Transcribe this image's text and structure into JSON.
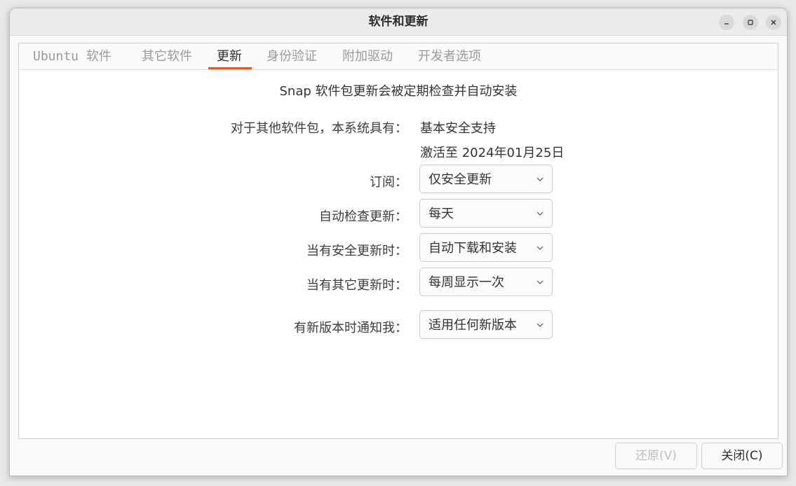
{
  "window": {
    "title": "软件和更新"
  },
  "tabs": [
    {
      "label": "Ubuntu 软件",
      "active": false
    },
    {
      "label": "其它软件",
      "active": false
    },
    {
      "label": "更新",
      "active": true
    },
    {
      "label": "身份验证",
      "active": false
    },
    {
      "label": "附加驱动",
      "active": false
    },
    {
      "label": "开发者选项",
      "active": false
    }
  ],
  "updates": {
    "snap_note": "Snap 软件包更新会被定期检查并自动安装",
    "other_packages_label": "对于其他软件包，本系统具有：",
    "other_packages_value": "基本安全支持",
    "activation": "激活至 2024年01月25日",
    "subscription_label": "订阅：",
    "subscription_value": "仅安全更新",
    "auto_check_label": "自动检查更新：",
    "auto_check_value": "每天",
    "security_updates_label": "当有安全更新时：",
    "security_updates_value": "自动下载和安装",
    "other_updates_label": "当有其它更新时：",
    "other_updates_value": "每周显示一次",
    "notify_label": "有新版本时通知我：",
    "notify_value": "适用任何新版本"
  },
  "buttons": {
    "revert": "还原(V)",
    "close": "关闭(C)"
  },
  "colors": {
    "accent": "#e95420"
  }
}
